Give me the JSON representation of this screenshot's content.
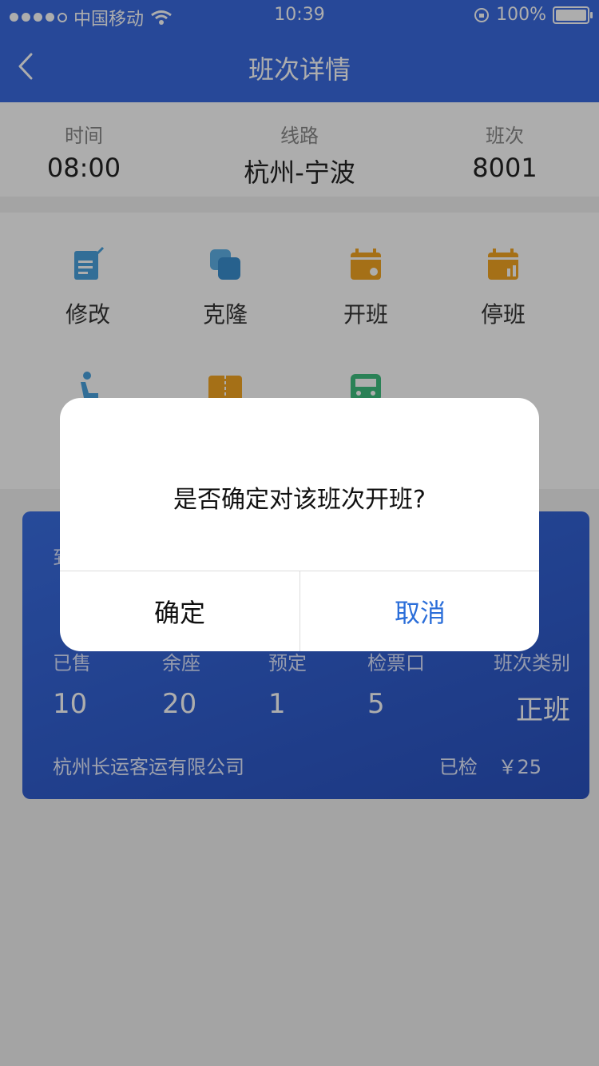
{
  "status": {
    "carrier": "中国移动",
    "time": "10:39",
    "battery": "100%"
  },
  "nav": {
    "title": "班次详情"
  },
  "info": {
    "time_label": "时间",
    "time_value": "08:00",
    "route_label": "线路",
    "route_value": "杭州-宁波",
    "trip_label": "班次",
    "trip_value": "8001"
  },
  "actions": [
    {
      "label": "修改",
      "icon": "edit-icon"
    },
    {
      "label": "克隆",
      "icon": "clone-icon"
    },
    {
      "label": "开班",
      "icon": "open-trip-icon"
    },
    {
      "label": "停班",
      "icon": "stop-trip-icon"
    },
    {
      "label": "",
      "icon": "seat-icon"
    },
    {
      "label": "",
      "icon": "ticket-icon"
    },
    {
      "label": "",
      "icon": "bus-icon"
    }
  ],
  "card": {
    "top_label": "到",
    "stats": [
      {
        "label": "已售",
        "value": "10"
      },
      {
        "label": "余座",
        "value": "20"
      },
      {
        "label": "预定",
        "value": "1"
      },
      {
        "label": "检票口",
        "value": "5"
      },
      {
        "label": "班次类别",
        "value": "正班"
      }
    ],
    "company": "杭州长运客运有限公司",
    "checked": "已检",
    "price": "￥25"
  },
  "dialog": {
    "message": "是否确定对该班次开班?",
    "confirm": "确定",
    "cancel": "取消"
  },
  "colors": {
    "primary": "#3a6be0",
    "card": "#2f5fd6",
    "link": "#2b6ed9"
  }
}
